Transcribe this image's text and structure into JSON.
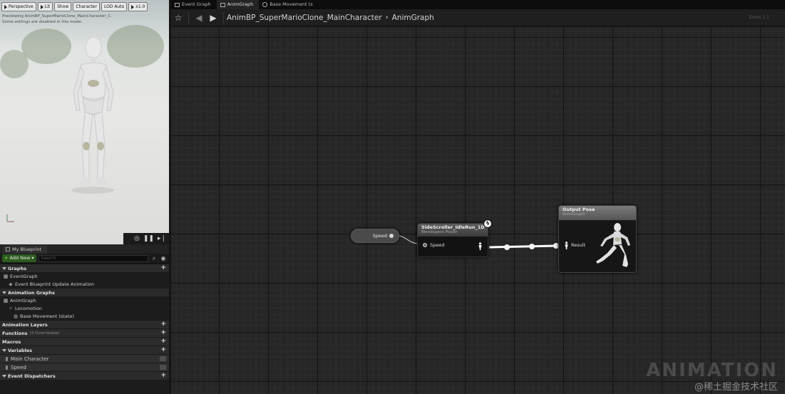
{
  "viewport": {
    "toolbar": [
      "Perspective",
      "Lit",
      "Show",
      "Character",
      "LOD Auto",
      "x1.0"
    ],
    "message_line1": "Previewing AnimBP_SuperMarioClone_MainCharacter_C.",
    "message_line2": "Some settings are disabled in this mode."
  },
  "tabs": [
    {
      "label": "Event Graph",
      "active": false
    },
    {
      "label": "AnimGraph",
      "active": true
    },
    {
      "label": "Base Movement (s",
      "active": false
    }
  ],
  "breadcrumb": {
    "root": "AnimBP_SuperMarioClone_MainCharacter",
    "current": "AnimGraph",
    "zoom": "Zoom 1:1"
  },
  "my_blueprint": {
    "tab_label": "My Blueprint",
    "add_new": "Add New",
    "search_placeholder": "Search",
    "sections": {
      "graphs": "Graphs",
      "event_graph": "EventGraph",
      "event_bp_update": "Event Blueprint Update Animation",
      "anim_graphs": "Animation Graphs",
      "anim_graph": "AnimGraph",
      "locomotion": "Locomotion",
      "base_movement": "Base Movement (state)",
      "anim_layers": "Animation Layers",
      "functions": "Functions",
      "functions_sub": "(3 Overridable)",
      "macros": "Macros",
      "variables": "Variables",
      "var_main_character": "Main Character",
      "var_speed": "Speed",
      "event_dispatchers": "Event Dispatchers"
    }
  },
  "graph": {
    "speed_node": "Speed",
    "blendspace_title": "SideScroller_IdleRun_1D",
    "blendspace_subtitle": "Blendspace Player",
    "blendspace_pin": "Speed",
    "output_title": "Output Pose",
    "output_subtitle": "AnimGraph",
    "output_pin": "Result"
  },
  "watermark": {
    "big": "ANIMATION",
    "small": "@稀土掘金技术社区"
  },
  "colors": {
    "graph_bg": "#262626",
    "add_new": "#2d5b1f",
    "wire": "#ffffff"
  }
}
